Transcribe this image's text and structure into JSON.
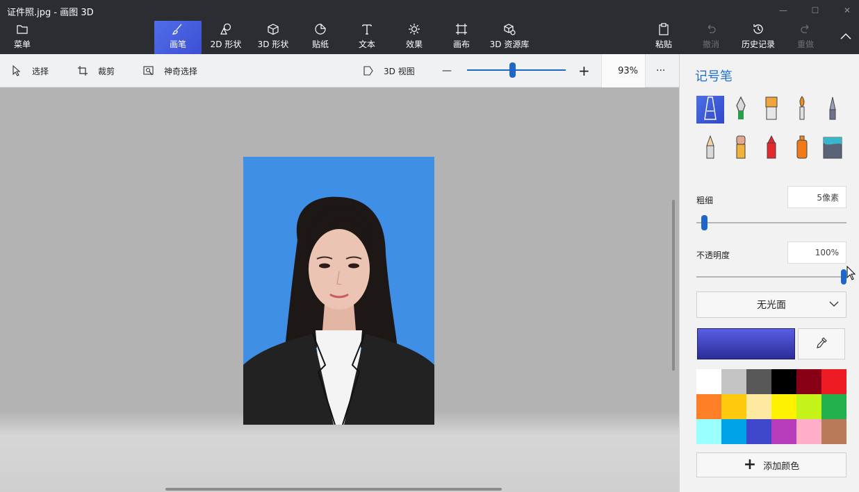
{
  "window": {
    "title": "证件照.jpg - 画图 3D",
    "minimize_glyph": "—",
    "maximize_glyph": "☐",
    "close_glyph": "✕"
  },
  "ribbon": {
    "menu": {
      "label": "菜单",
      "icon": "folder-icon"
    },
    "tools": [
      {
        "label": "画笔",
        "icon": "brush-icon",
        "active": true
      },
      {
        "label": "2D 形状",
        "icon": "2d-shapes-icon"
      },
      {
        "label": "3D 形状",
        "icon": "3d-shapes-icon"
      },
      {
        "label": "贴纸",
        "icon": "sticker-icon"
      },
      {
        "label": "文本",
        "icon": "text-icon"
      },
      {
        "label": "效果",
        "icon": "effects-icon"
      },
      {
        "label": "画布",
        "icon": "canvas-icon"
      },
      {
        "label": "3D 资源库",
        "icon": "3d-library-icon"
      }
    ],
    "right": [
      {
        "label": "粘贴",
        "icon": "paste-icon",
        "enabled": true
      },
      {
        "label": "撤消",
        "icon": "undo-icon",
        "enabled": false
      },
      {
        "label": "历史记录",
        "icon": "history-icon",
        "enabled": true
      },
      {
        "label": "重做",
        "icon": "redo-icon",
        "enabled": false
      }
    ],
    "collapse_icon": "chevron-up-icon"
  },
  "toolbar": {
    "select_label": "选择",
    "crop_label": "裁剪",
    "magic_select_label": "神奇选择",
    "view3d_label": "3D 视图",
    "zoom_out_glyph": "—",
    "zoom_in_glyph": "+",
    "zoom_value": "93%",
    "more_glyph": "···"
  },
  "panel": {
    "title": "记号笔",
    "brushes": [
      "marker-icon",
      "calligraphy-pen-icon",
      "oil-brush-icon",
      "watercolor-icon",
      "pixel-pen-icon",
      "pencil-icon",
      "eraser-icon",
      "crayon-icon",
      "spray-can-icon",
      "fill-bucket-icon"
    ],
    "thickness_label": "粗细",
    "thickness_value": "5像素",
    "thickness_level": 0.05,
    "opacity_label": "不透明度",
    "opacity_value": "100%",
    "opacity_level": 1.0,
    "finish_value": "无光面",
    "current_color": "#3b3fb8",
    "palette": [
      "#ffffff",
      "#c3c3c3",
      "#585858",
      "#000000",
      "#880015",
      "#ed1c24",
      "#ff7f27",
      "#ffc90e",
      "#fde9a0",
      "#fff200",
      "#c4f31a",
      "#22b14c",
      "#99ffff",
      "#00a2e8",
      "#3f48cc",
      "#b83dba",
      "#ffaec9",
      "#b97a57"
    ],
    "add_color_label": "添加颜色"
  }
}
